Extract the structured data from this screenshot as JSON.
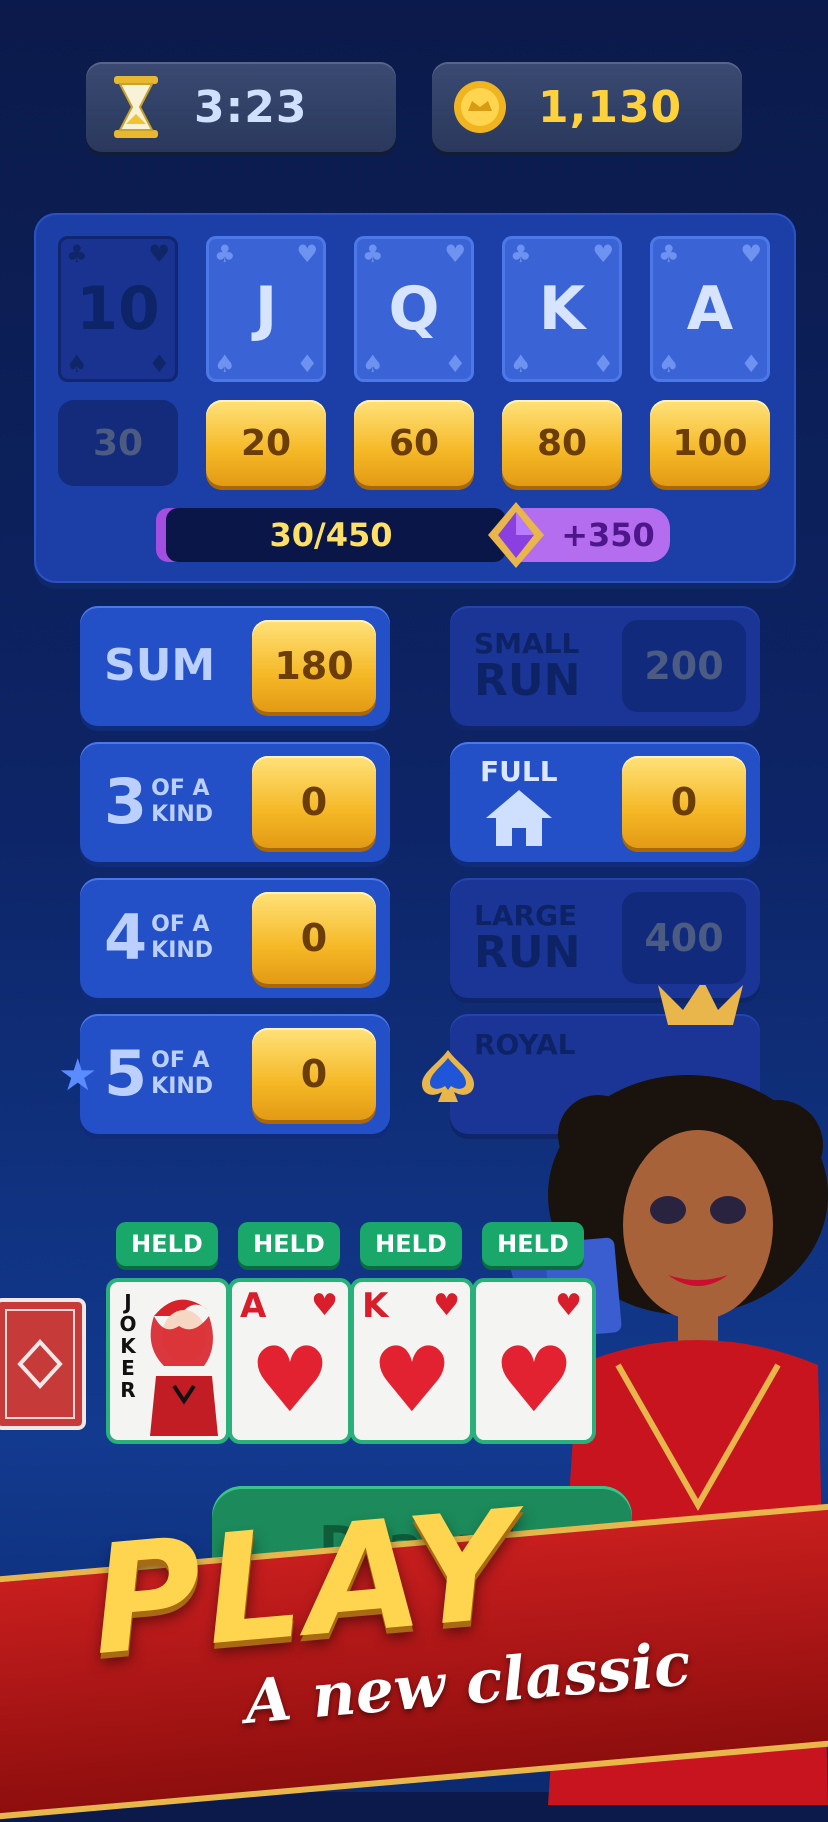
{
  "header": {
    "timer_icon": "hourglass-icon",
    "timer": "3:23",
    "coin_icon": "coin-icon",
    "coins": "1,130"
  },
  "top_row": {
    "cards": [
      "10",
      "J",
      "Q",
      "K",
      "A"
    ],
    "scores": [
      "30",
      "20",
      "60",
      "80",
      "100"
    ],
    "progress_text": "30/450",
    "progress_fraction": 0.067,
    "bonus": "+350",
    "bonus_icon": "gem-icon"
  },
  "combos": {
    "sum": {
      "label": "SUM",
      "value": "180"
    },
    "three_kind": {
      "big": "3",
      "small1": "OF A",
      "small2": "KIND",
      "value": "0"
    },
    "four_kind": {
      "big": "4",
      "small1": "OF A",
      "small2": "KIND",
      "value": "0"
    },
    "five_kind": {
      "big": "5",
      "small1": "OF A",
      "small2": "KIND",
      "value": "0"
    },
    "small_run": {
      "l1": "SMALL",
      "l2": "RUN",
      "value": "200"
    },
    "full_house": {
      "l1": "FULL",
      "icon": "house-icon",
      "value": "0"
    },
    "large_run": {
      "l1": "LARGE",
      "l2": "RUN",
      "value": "400"
    },
    "royal": {
      "l1": "ROYAL"
    }
  },
  "hand": {
    "held_labels": [
      "HELD",
      "HELD",
      "HELD",
      "HELD"
    ],
    "cards": [
      {
        "rank": "JOKER"
      },
      {
        "rank": "A",
        "suit": "♥"
      },
      {
        "rank": "K",
        "suit": "♥"
      },
      {
        "rank": "",
        "suit": "♥"
      }
    ]
  },
  "draw_button": "Draw 1",
  "banner": {
    "title": "PLAY",
    "subtitle": "A new classic"
  }
}
